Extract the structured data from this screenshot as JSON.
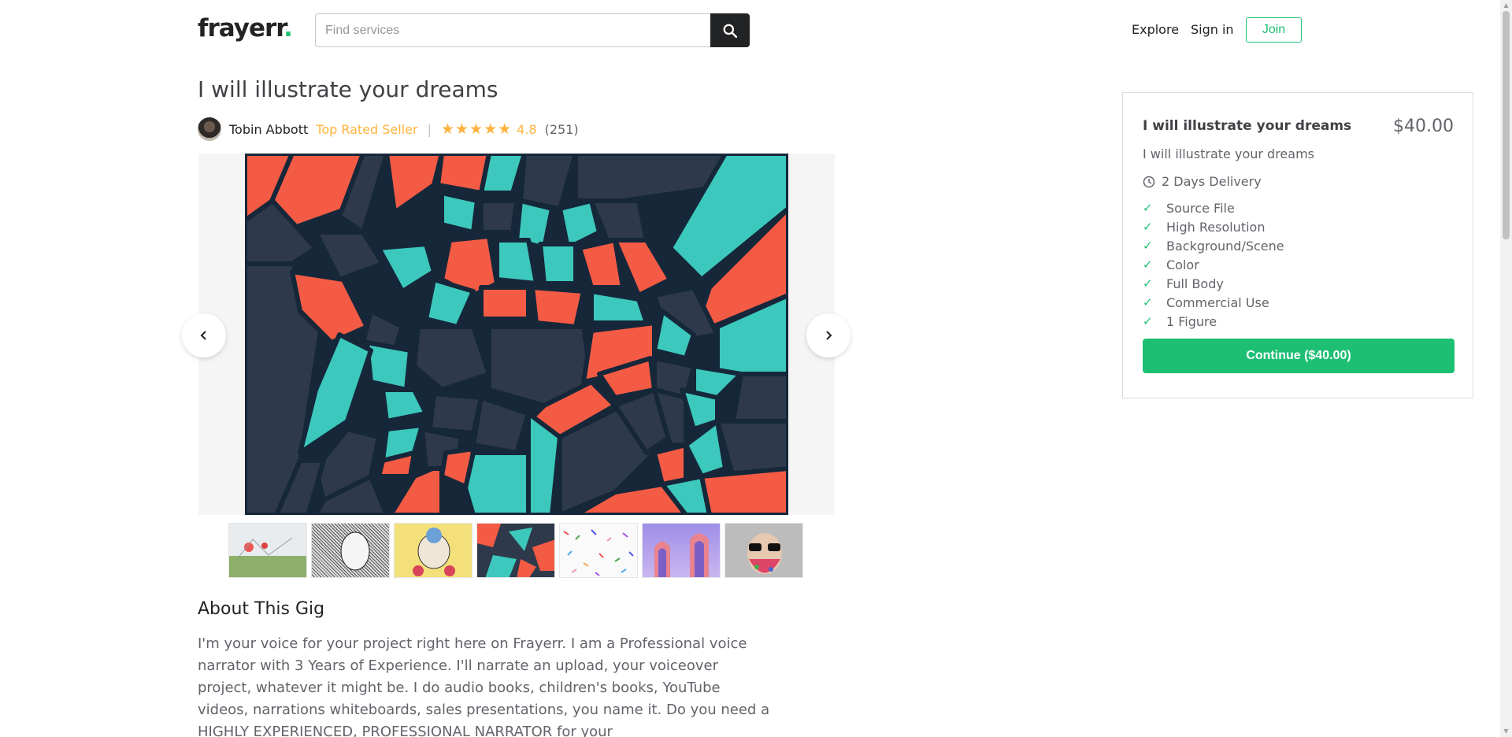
{
  "header": {
    "logo_text": "frayerr",
    "logo_dot": ".",
    "search_placeholder": "Find services",
    "nav": {
      "explore": "Explore",
      "sign_in": "Sign in",
      "join": "Join"
    }
  },
  "gig": {
    "title": "I will illustrate your dreams",
    "seller_name": "Tobin Abbott",
    "seller_badge": "Top Rated Seller",
    "separator": "|",
    "stars": "★★★★★",
    "rating": "4.8",
    "review_count": "(251)",
    "thumbnails": [
      "thumb-1",
      "thumb-2",
      "thumb-3",
      "thumb-4",
      "thumb-5",
      "thumb-6",
      "thumb-7"
    ],
    "about_title": "About This Gig",
    "about_text": "I'm your voice for your project right here on Frayerr. I am a Professional voice narrator with 3 Years of Experience. I'll narrate an upload, your voiceover project, whatever it might be. I do audio books, children's books, YouTube videos, narrations whiteboards, sales presentations, you name it. Do you need a HIGHLY EXPERIENCED, PROFESSIONAL NARRATOR for your"
  },
  "package": {
    "title": "I will illustrate your dreams",
    "price": "$40.00",
    "description": "I will illustrate your dreams",
    "delivery": "2 Days Delivery",
    "features": [
      "Source File",
      "High Resolution",
      "Background/Scene",
      "Color",
      "Full Body",
      "Commercial Use",
      "1 Figure"
    ],
    "continue_label": "Continue ($40.00)"
  },
  "colors": {
    "brand": "#1dbf73",
    "star": "#ffb33e",
    "text": "#404145"
  },
  "icons": {
    "search": "search-icon",
    "prev": "chevron-left-icon",
    "next": "chevron-right-icon",
    "clock": "clock-icon",
    "check": "check-icon"
  }
}
